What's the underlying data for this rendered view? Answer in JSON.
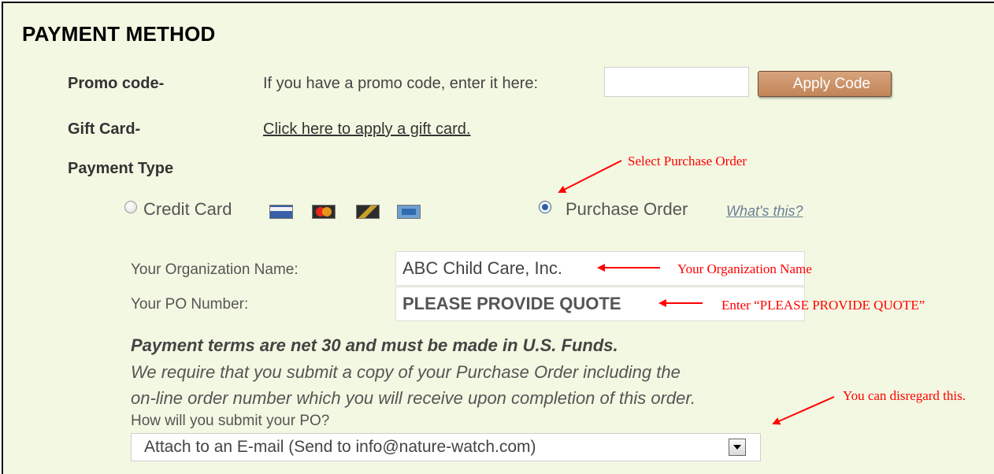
{
  "section_title": "PAYMENT METHOD",
  "promo": {
    "label": "Promo code-",
    "prompt": "If you have a promo code, enter it here:",
    "value": "",
    "apply_label": "Apply Code"
  },
  "gift_card": {
    "label": "Gift Card-",
    "link_text": "Click here to apply a gift card."
  },
  "payment_type": {
    "label": "Payment Type",
    "options": [
      {
        "label": "Credit Card",
        "selected": false,
        "cards": [
          "visa-card-icon",
          "mastercard-card-icon",
          "discover-card-icon",
          "amex-card-icon"
        ]
      },
      {
        "label": "Purchase Order",
        "selected": true
      }
    ],
    "whats_this": "What's this?"
  },
  "po_form": {
    "org_label": "Your Organization Name:",
    "org_value": "ABC Child Care, Inc.",
    "po_label": "Your PO Number:",
    "po_value": "PLEASE PROVIDE QUOTE",
    "terms_bold": "Payment terms are net 30 and must be made in U.S. Funds.",
    "requirement_line1": "We require that you submit a copy of your Purchase Order including the",
    "requirement_line2": "on-line order number which you will receive upon completion of this order.",
    "submit_question": "How will you submit your PO?",
    "submit_selected": "Attach to an E-mail (Send to info@nature-watch.com)"
  },
  "annotations": {
    "select_po": "Select Purchase Order",
    "org_name": "Your Organization Name",
    "enter_quote": "Enter  “PLEASE PROVIDE QUOTE”",
    "disregard": "You can disregard this."
  },
  "colors": {
    "panel_bg": "#f3f8e2",
    "annotation": "#ff0000",
    "button": "#c99068",
    "link_blue": "#6b7f98"
  }
}
